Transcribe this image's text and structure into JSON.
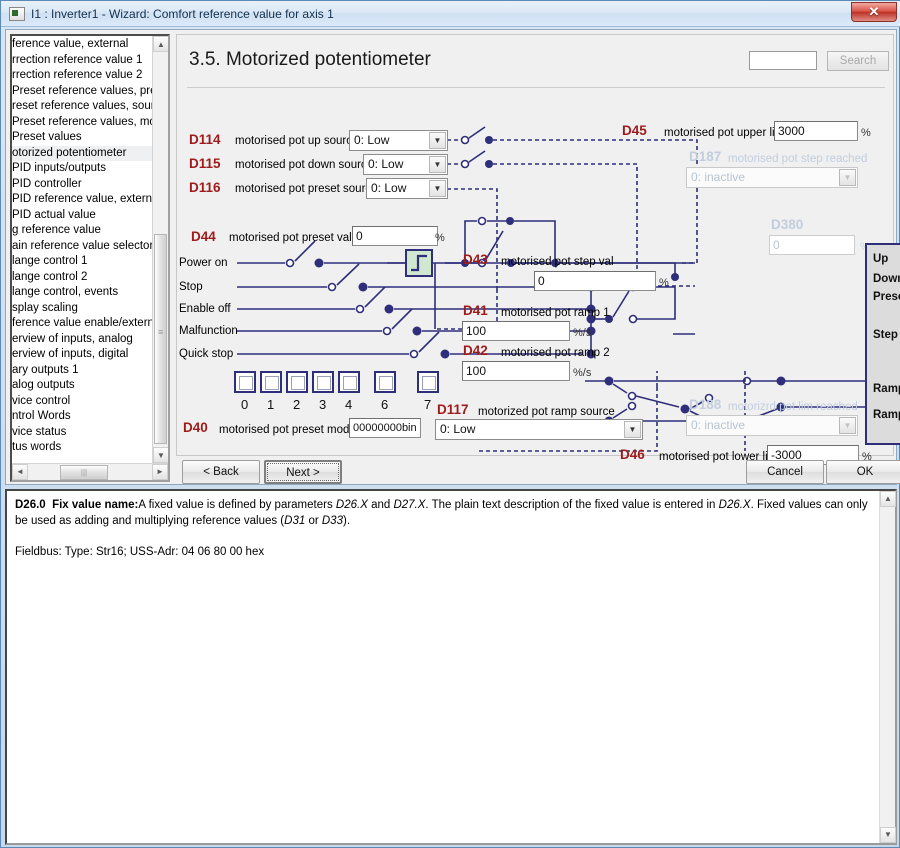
{
  "window": {
    "title": "I1 : Inverter1 - Wizard: Comfort reference value for axis 1",
    "close_label": "✕"
  },
  "sidebar": {
    "items": [
      {
        "label": "ference value, external",
        "selected": false
      },
      {
        "label": "rrection reference value 1",
        "selected": false
      },
      {
        "label": "rrection reference value 2",
        "selected": false
      },
      {
        "label": "Preset reference values, prese",
        "selected": false
      },
      {
        "label": "reset reference values, sourc",
        "selected": false
      },
      {
        "label": "Preset reference values, monit",
        "selected": false
      },
      {
        "label": "Preset values",
        "selected": false
      },
      {
        "label": "otorized potentiometer",
        "selected": true
      },
      {
        "label": "PID inputs/outputs",
        "selected": false
      },
      {
        "label": "PID controller",
        "selected": false
      },
      {
        "label": "PID reference value, external",
        "selected": false
      },
      {
        "label": "PID actual value",
        "selected": false
      },
      {
        "label": "g reference value",
        "selected": false
      },
      {
        "label": "ain reference value selector",
        "selected": false
      },
      {
        "label": "lange control 1",
        "selected": false
      },
      {
        "label": "lange control 2",
        "selected": false
      },
      {
        "label": "lange control, events",
        "selected": false
      },
      {
        "label": "splay scaling",
        "selected": false
      },
      {
        "label": "ference value enable/externa",
        "selected": false
      },
      {
        "label": "erview of inputs, analog",
        "selected": false
      },
      {
        "label": "erview of inputs, digital",
        "selected": false
      },
      {
        "label": "ary outputs 1",
        "selected": false
      },
      {
        "label": "alog outputs",
        "selected": false
      },
      {
        "label": "vice control",
        "selected": false
      },
      {
        "label": "ntrol Words",
        "selected": false
      },
      {
        "label": "vice status",
        "selected": false
      },
      {
        "label": "tus words",
        "selected": false
      }
    ]
  },
  "content": {
    "page_title": "3.5. Motorized potentiometer",
    "search": {
      "value": "",
      "placeholder": "",
      "button_label": "Search"
    }
  },
  "parameters": {
    "d114": {
      "code": "D114",
      "label": "motorised pot up source",
      "value": "0: Low"
    },
    "d115": {
      "code": "D115",
      "label": "motorised pot down source",
      "value": "0: Low"
    },
    "d116": {
      "code": "D116",
      "label": "motorised pot preset source",
      "value": "0: Low"
    },
    "d44": {
      "code": "D44",
      "label": "motorised pot preset value",
      "value": "0",
      "unit": "%"
    },
    "d45": {
      "code": "D45",
      "label": "motorised pot upper limit",
      "value": "3000",
      "unit": "%"
    },
    "d187": {
      "code": "D187",
      "label": "motorised pot step reached",
      "value": "0: inactive"
    },
    "d380": {
      "code": "D380",
      "label": "",
      "value": "0",
      "unit": "%"
    },
    "d43": {
      "code": "D43",
      "label": "motorised pot step val",
      "value": "0",
      "unit": "%"
    },
    "d41": {
      "code": "D41",
      "label": "motorised pot ramp 1",
      "value": "100",
      "unit": "%/s"
    },
    "d42": {
      "code": "D42",
      "label": "motorised pot ramp 2",
      "value": "100",
      "unit": "%/s"
    },
    "d40": {
      "code": "D40",
      "label": "motorised pot preset mode",
      "value": "00000000bin"
    },
    "d117": {
      "code": "D117",
      "label": "motorized pot ramp source",
      "value": "0: Low"
    },
    "d188": {
      "code": "D188",
      "label": "motorizrd pot lim reached",
      "value": "0: inactive"
    },
    "d46": {
      "code": "D46",
      "label": "motorised pot lower limit",
      "value": "-3000",
      "unit": "%"
    }
  },
  "signals": {
    "rows": [
      "Power on",
      "Stop",
      "Enable off",
      "Malfunction",
      "Quick stop"
    ],
    "checkbox_numbers": [
      "0",
      "1",
      "2",
      "3",
      "4",
      "6",
      "7"
    ]
  },
  "function_block": {
    "inputs": [
      "Up",
      "Down",
      "Preset",
      "Step value",
      "Ramp up",
      "Ramp down"
    ]
  },
  "buttons": {
    "back": "< Back",
    "next": "Next >",
    "cancel": "Cancel",
    "ok": "OK"
  },
  "description": {
    "code": "D26.0",
    "title": "Fix value name:",
    "body_1": "A fixed value is defined by parameters ",
    "it_1": "D26.X",
    "body_2": " and ",
    "it_2": "D27.X",
    "body_3": ". The plain text description of the fixed value is entered in ",
    "it_3": "D26.X",
    "body_4": ". Fixed values can only be used as adding and multiplying reference values (",
    "it_4": "D31",
    "body_5": " or ",
    "it_5": "D33",
    "body_6": ").",
    "fieldbus": "Fieldbus: Type: Str16; USS-Adr: 04 06 80 00 hex"
  },
  "colors": {
    "param_code": "#9e1b1b",
    "wire": "#2e2e7a",
    "block_fill": "#dcdcdc",
    "dim_text": "#c2cede",
    "accent_arrow": "#b23a2a"
  }
}
